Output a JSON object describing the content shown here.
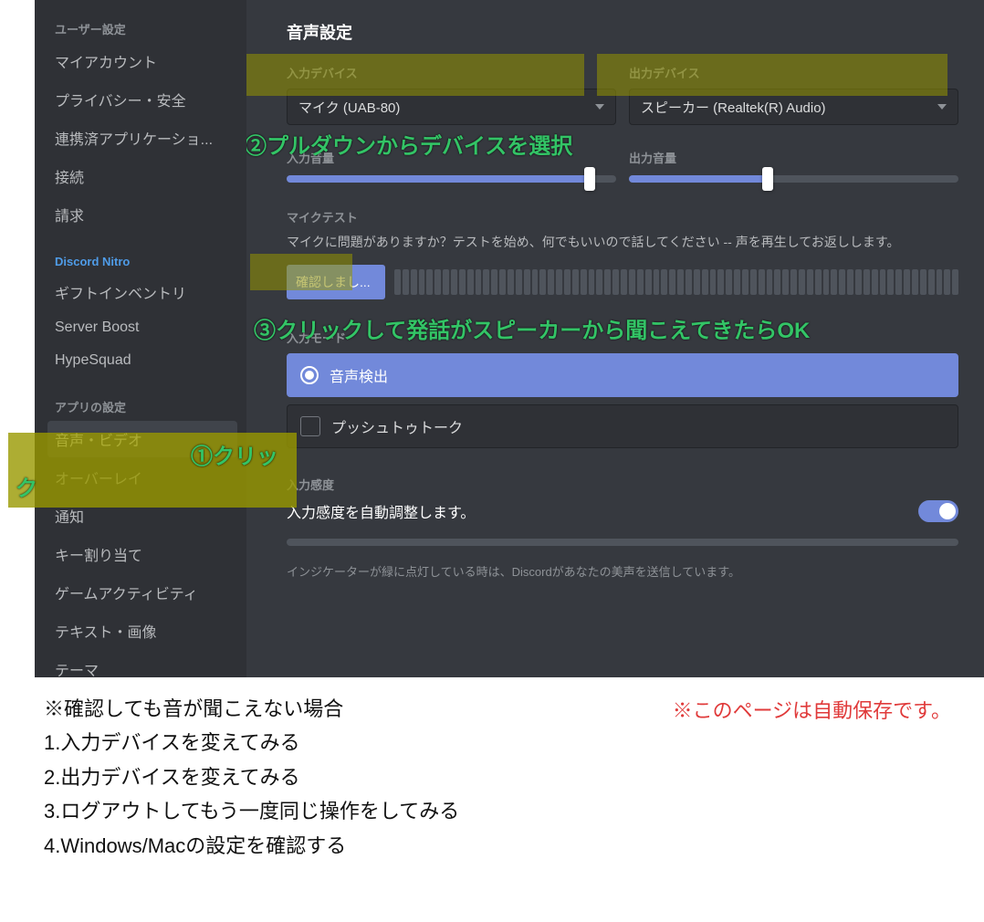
{
  "sidebar": {
    "headers": {
      "user": "ユーザー設定",
      "nitro": "Discord Nitro",
      "app": "アプリの設定"
    },
    "user_items": [
      "マイアカウント",
      "プライバシー・安全",
      "連携済アプリケーショ...",
      "接続",
      "請求"
    ],
    "nitro_items": [
      "ギフトインベントリ",
      "Server Boost",
      "HypeSquad"
    ],
    "app_items": [
      "音声・ビデオ",
      "オーバーレイ",
      "通知",
      "キー割り当て",
      "ゲームアクティビティ",
      "テキスト・画像",
      "テーマ"
    ]
  },
  "page_title": "音声設定",
  "input_device": {
    "label": "入力デバイス",
    "value": "マイク (UAB-80)"
  },
  "output_device": {
    "label": "出力デバイス",
    "value": "スピーカー (Realtek(R) Audio)"
  },
  "input_volume_label": "入力音量",
  "output_volume_label": "出力音量",
  "mic_test": {
    "label": "マイクテスト",
    "desc": "マイクに問題がありますか？テストを始め、何でもいいので話してください -- 声を再生してお返しします。",
    "button": "確認しまし..."
  },
  "input_mode": {
    "label": "入力モード",
    "voice_activity": "音声検出",
    "ptt": "プッシュトゥトーク"
  },
  "sensitivity": {
    "label": "入力感度",
    "desc": "入力感度を自動調整します。",
    "indicator": "インジケーターが緑に点灯している時は、Discordがあなたの美声を送信しています。"
  },
  "annotations": {
    "a1": "①クリック",
    "a2": "②プルダウンからデバイスを選択",
    "a3": "③クリックして発話がスピーカーから聞こえてきたらOK"
  },
  "instructions": {
    "head": "※確認しても音が聞こえない場合",
    "lines": [
      "1.入力デバイスを変えてみる",
      "2.出力デバイスを変えてみる",
      "3.ログアウトしてもう一度同じ操作をしてみる",
      "4.Windows/Macの設定を確認する"
    ],
    "autosave": "※このページは自動保存です。"
  }
}
